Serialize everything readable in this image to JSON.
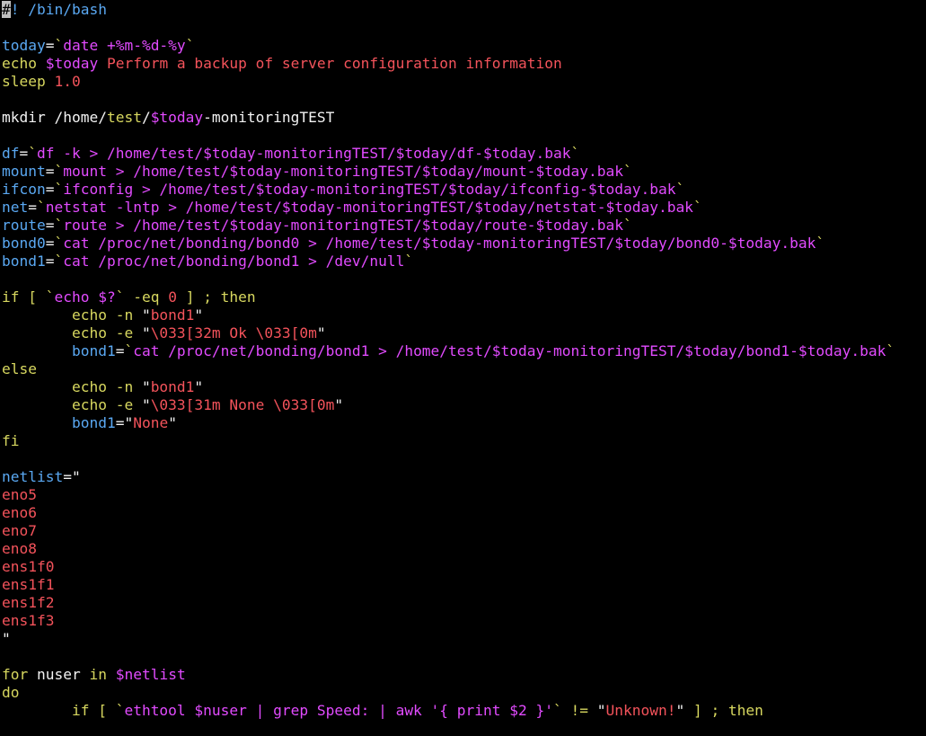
{
  "terminal": {
    "background": "#000000",
    "palette": {
      "default": "#f2f2f2",
      "yellow": "#d7d75f",
      "magenta": "#e24bff",
      "red": "#f4535b",
      "blue": "#5aa8f2",
      "cursor_bg": "#c0c0c0",
      "cursor_fg": "#000000"
    },
    "lines": [
      [
        {
          "t": "#",
          "c": "cursor"
        },
        {
          "t": "! /bin/bash",
          "c": "blue"
        }
      ],
      [],
      [
        {
          "t": "today",
          "c": "blue"
        },
        {
          "t": "=",
          "c": "default"
        },
        {
          "t": "`",
          "c": "yellow"
        },
        {
          "t": "date +%m-%d-%y",
          "c": "magenta"
        },
        {
          "t": "`",
          "c": "yellow"
        }
      ],
      [
        {
          "t": "echo ",
          "c": "yellow"
        },
        {
          "t": "$today",
          "c": "magenta"
        },
        {
          "t": " Perform a backup of server configuration information",
          "c": "red"
        }
      ],
      [
        {
          "t": "sleep ",
          "c": "yellow"
        },
        {
          "t": "1.0",
          "c": "red"
        }
      ],
      [],
      [
        {
          "t": "mkdir /home/",
          "c": "default"
        },
        {
          "t": "test",
          "c": "yellow"
        },
        {
          "t": "/",
          "c": "default"
        },
        {
          "t": "$today",
          "c": "magenta"
        },
        {
          "t": "-monitoringTEST",
          "c": "default"
        }
      ],
      [],
      [
        {
          "t": "df",
          "c": "blue"
        },
        {
          "t": "=",
          "c": "default"
        },
        {
          "t": "`",
          "c": "yellow"
        },
        {
          "t": "df -k > /home/test/$today-monitoringTEST/$today/df-$today.bak",
          "c": "magenta"
        },
        {
          "t": "`",
          "c": "yellow"
        }
      ],
      [
        {
          "t": "mount",
          "c": "blue"
        },
        {
          "t": "=",
          "c": "default"
        },
        {
          "t": "`",
          "c": "yellow"
        },
        {
          "t": "mount > /home/test/$today-monitoringTEST/$today/mount-$today.bak",
          "c": "magenta"
        },
        {
          "t": "`",
          "c": "yellow"
        }
      ],
      [
        {
          "t": "ifcon",
          "c": "blue"
        },
        {
          "t": "=",
          "c": "default"
        },
        {
          "t": "`",
          "c": "yellow"
        },
        {
          "t": "ifconfig > /home/test/$today-monitoringTEST/$today/ifconfig-$today.bak",
          "c": "magenta"
        },
        {
          "t": "`",
          "c": "yellow"
        }
      ],
      [
        {
          "t": "net",
          "c": "blue"
        },
        {
          "t": "=",
          "c": "default"
        },
        {
          "t": "`",
          "c": "yellow"
        },
        {
          "t": "netstat -lntp > /home/test/$today-monitoringTEST/$today/netstat-$today.bak",
          "c": "magenta"
        },
        {
          "t": "`",
          "c": "yellow"
        }
      ],
      [
        {
          "t": "route",
          "c": "blue"
        },
        {
          "t": "=",
          "c": "default"
        },
        {
          "t": "`",
          "c": "yellow"
        },
        {
          "t": "route > /home/test/$today-monitoringTEST/$today/route-$today.bak",
          "c": "magenta"
        },
        {
          "t": "`",
          "c": "yellow"
        }
      ],
      [
        {
          "t": "bond0",
          "c": "blue"
        },
        {
          "t": "=",
          "c": "default"
        },
        {
          "t": "`",
          "c": "yellow"
        },
        {
          "t": "cat /proc/net/bonding/bond0 > /home/test/$today-monitoringTEST/$today/bond0-$today.bak",
          "c": "magenta"
        },
        {
          "t": "`",
          "c": "yellow"
        }
      ],
      [
        {
          "t": "bond1",
          "c": "blue"
        },
        {
          "t": "=",
          "c": "default"
        },
        {
          "t": "`",
          "c": "yellow"
        },
        {
          "t": "cat /proc/net/bonding/bond1 > /dev/null",
          "c": "magenta"
        },
        {
          "t": "`",
          "c": "yellow"
        }
      ],
      [],
      [
        {
          "t": "if [ ",
          "c": "yellow"
        },
        {
          "t": "`",
          "c": "yellow"
        },
        {
          "t": "echo $?",
          "c": "magenta"
        },
        {
          "t": "`",
          "c": "yellow"
        },
        {
          "t": " -eq ",
          "c": "yellow"
        },
        {
          "t": "0",
          "c": "red"
        },
        {
          "t": " ] ; then",
          "c": "yellow"
        }
      ],
      [
        {
          "t": "        echo -n ",
          "c": "yellow"
        },
        {
          "t": "\"",
          "c": "default"
        },
        {
          "t": "bond1",
          "c": "red"
        },
        {
          "t": "\"",
          "c": "default"
        }
      ],
      [
        {
          "t": "        echo -e ",
          "c": "yellow"
        },
        {
          "t": "\"",
          "c": "default"
        },
        {
          "t": "\\033[32m Ok \\033[0m",
          "c": "red"
        },
        {
          "t": "\"",
          "c": "default"
        }
      ],
      [
        {
          "t": "        bond1",
          "c": "blue"
        },
        {
          "t": "=",
          "c": "default"
        },
        {
          "t": "`",
          "c": "yellow"
        },
        {
          "t": "cat /proc/net/bonding/bond1 > /home/test/$today-monitoringTEST/$today/bond1-$today.bak",
          "c": "magenta"
        },
        {
          "t": "`",
          "c": "yellow"
        }
      ],
      [
        {
          "t": "else",
          "c": "yellow"
        }
      ],
      [
        {
          "t": "        echo -n ",
          "c": "yellow"
        },
        {
          "t": "\"",
          "c": "default"
        },
        {
          "t": "bond1",
          "c": "red"
        },
        {
          "t": "\"",
          "c": "default"
        }
      ],
      [
        {
          "t": "        echo -e ",
          "c": "yellow"
        },
        {
          "t": "\"",
          "c": "default"
        },
        {
          "t": "\\033[31m None \\033[0m",
          "c": "red"
        },
        {
          "t": "\"",
          "c": "default"
        }
      ],
      [
        {
          "t": "        bond1",
          "c": "blue"
        },
        {
          "t": "=",
          "c": "default"
        },
        {
          "t": "\"",
          "c": "default"
        },
        {
          "t": "None",
          "c": "red"
        },
        {
          "t": "\"",
          "c": "default"
        }
      ],
      [
        {
          "t": "fi",
          "c": "yellow"
        }
      ],
      [],
      [
        {
          "t": "netlist",
          "c": "blue"
        },
        {
          "t": "=",
          "c": "default"
        },
        {
          "t": "\"",
          "c": "default"
        }
      ],
      [
        {
          "t": "eno5",
          "c": "red"
        }
      ],
      [
        {
          "t": "eno6",
          "c": "red"
        }
      ],
      [
        {
          "t": "eno7",
          "c": "red"
        }
      ],
      [
        {
          "t": "eno8",
          "c": "red"
        }
      ],
      [
        {
          "t": "ens1f0",
          "c": "red"
        }
      ],
      [
        {
          "t": "ens1f1",
          "c": "red"
        }
      ],
      [
        {
          "t": "ens1f2",
          "c": "red"
        }
      ],
      [
        {
          "t": "ens1f3",
          "c": "red"
        }
      ],
      [
        {
          "t": "\"",
          "c": "default"
        }
      ],
      [],
      [
        {
          "t": "for ",
          "c": "yellow"
        },
        {
          "t": "nuser ",
          "c": "default"
        },
        {
          "t": "in ",
          "c": "yellow"
        },
        {
          "t": "$netlist",
          "c": "magenta"
        }
      ],
      [
        {
          "t": "do",
          "c": "yellow"
        }
      ],
      [
        {
          "t": "        if [ ",
          "c": "yellow"
        },
        {
          "t": "`",
          "c": "yellow"
        },
        {
          "t": "ethtool $nuser | grep Speed: | awk '{ print $2 }'",
          "c": "magenta"
        },
        {
          "t": "`",
          "c": "yellow"
        },
        {
          "t": " != ",
          "c": "yellow"
        },
        {
          "t": "\"",
          "c": "default"
        },
        {
          "t": "Unknown!",
          "c": "red"
        },
        {
          "t": "\"",
          "c": "default"
        },
        {
          "t": " ] ; then",
          "c": "yellow"
        }
      ]
    ]
  }
}
